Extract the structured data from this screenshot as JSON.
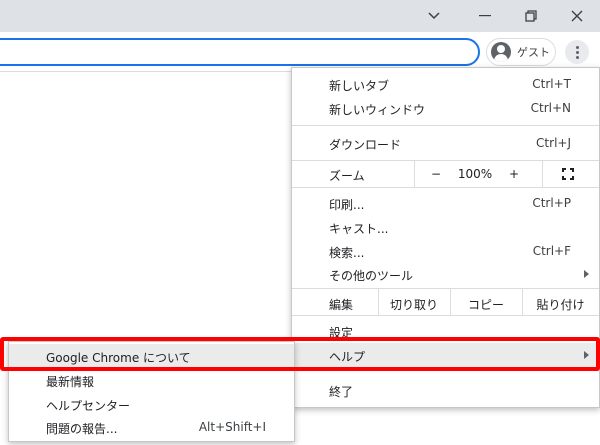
{
  "menu": {
    "new_tab": {
      "label": "新しいタブ",
      "shortcut": "Ctrl+T"
    },
    "new_window": {
      "label": "新しいウィンドウ",
      "shortcut": "Ctrl+N"
    },
    "downloads": {
      "label": "ダウンロード",
      "shortcut": "Ctrl+J"
    },
    "zoom": {
      "label": "ズーム",
      "minus": "−",
      "value": "100%",
      "plus": "+"
    },
    "print": {
      "label": "印刷...",
      "shortcut": "Ctrl+P"
    },
    "cast": {
      "label": "キャスト..."
    },
    "search": {
      "label": "検索...",
      "shortcut": "Ctrl+F"
    },
    "more_tools": {
      "label": "その他のツール"
    },
    "edit": {
      "label": "編集",
      "cut": "切り取り",
      "copy": "コピー",
      "paste": "貼り付け"
    },
    "settings": {
      "label": "設定"
    },
    "help": {
      "label": "ヘルプ"
    },
    "exit": {
      "label": "終了"
    }
  },
  "help_submenu": {
    "about": {
      "label": "Google Chrome について"
    },
    "whats_new": {
      "label": "最新情報"
    },
    "help_center": {
      "label": "ヘルプセンター"
    },
    "report_issue": {
      "label": "問題の報告...",
      "shortcut": "Alt+Shift+I"
    }
  },
  "profile": {
    "label": "ゲスト"
  },
  "colors": {
    "highlight": "#ff0000",
    "omnibox_focus": "#1a73e8"
  }
}
